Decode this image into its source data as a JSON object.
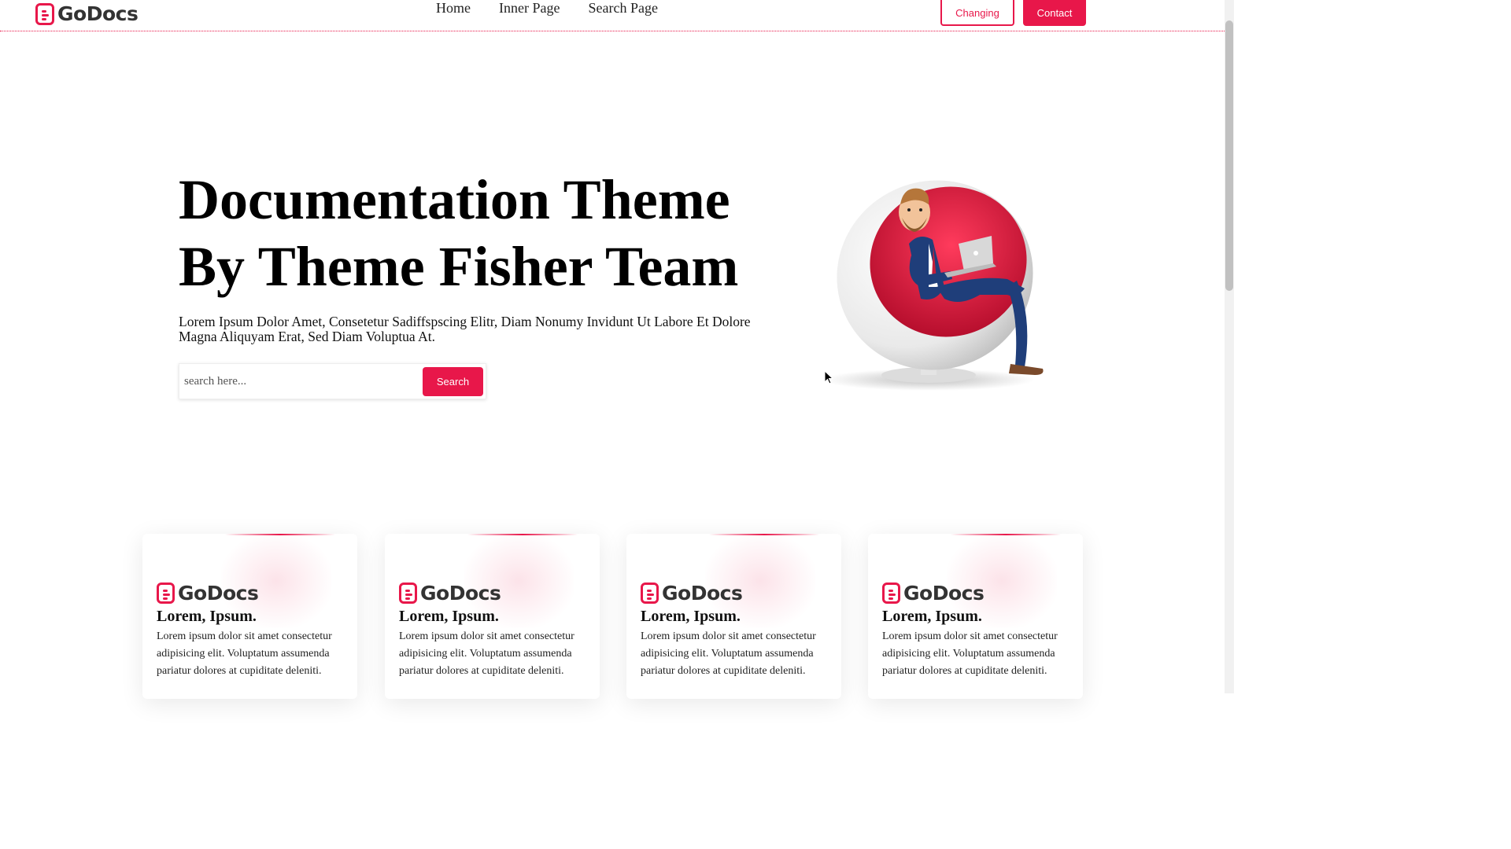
{
  "brand": {
    "name": "GoDocs",
    "accent": "#e8174a"
  },
  "nav": {
    "items": [
      "Home",
      "Inner Page",
      "Search Page"
    ]
  },
  "header": {
    "changing_label": "Changing",
    "contact_label": "Contact"
  },
  "hero": {
    "title_line1": "Documentation Theme",
    "title_line2": "By Theme Fisher Team",
    "subtitle": "Lorem Ipsum Dolor Amet, Consetetur Sadiffspscing Elitr, Diam Nonumy Invidunt Ut Labore Et Dolore Magna Aliquyam Erat, Sed Diam Voluptua At.",
    "search_placeholder": "search here...",
    "search_button": "Search"
  },
  "cards": [
    {
      "logo": "GoDocs",
      "title": "Lorem, Ipsum.",
      "text": "Lorem ipsum dolor sit amet consectetur adipisicing elit. Voluptatum assumenda pariatur dolores at cupiditate deleniti."
    },
    {
      "logo": "GoDocs",
      "title": "Lorem, Ipsum.",
      "text": "Lorem ipsum dolor sit amet consectetur adipisicing elit. Voluptatum assumenda pariatur dolores at cupiditate deleniti."
    },
    {
      "logo": "GoDocs",
      "title": "Lorem, Ipsum.",
      "text": "Lorem ipsum dolor sit amet consectetur adipisicing elit. Voluptatum assumenda pariatur dolores at cupiditate deleniti."
    },
    {
      "logo": "GoDocs",
      "title": "Lorem, Ipsum.",
      "text": "Lorem ipsum dolor sit amet consectetur adipisicing elit. Voluptatum assumenda pariatur dolores at cupiditate deleniti."
    }
  ],
  "illustration": {
    "name": "man-in-egg-chair-with-laptop"
  }
}
